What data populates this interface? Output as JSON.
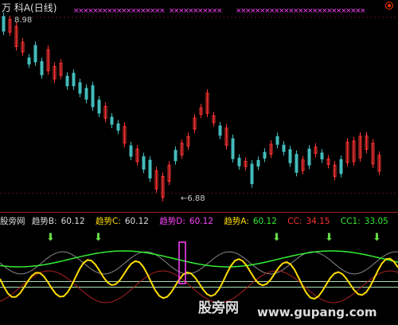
{
  "header": {
    "title": "万  科A(日线)",
    "high_price": "8.98",
    "low_price": "←6.88"
  },
  "indicator": {
    "panel_name": "股旁网",
    "trend_b": {
      "label": "趋势B:",
      "value": "60.12"
    },
    "trend_c": {
      "label": "趋势C:",
      "value": "60.12"
    },
    "trend_d": {
      "label": "趋势D:",
      "value": "60.12"
    },
    "trend_a": {
      "label": "趋势A:",
      "value": "60.12"
    },
    "cc": {
      "label": "CC:",
      "value": "34.15"
    },
    "cc1": {
      "label": "CC1:",
      "value": "33.05"
    }
  },
  "watermark": {
    "site": "股旁网",
    "url": "www.gupang.com"
  },
  "colors": {
    "up": "#ff3333",
    "down": "#44bbbb",
    "trend": "#ffdd00",
    "marker": "#ff44ff",
    "signal": "#33ee33"
  }
}
